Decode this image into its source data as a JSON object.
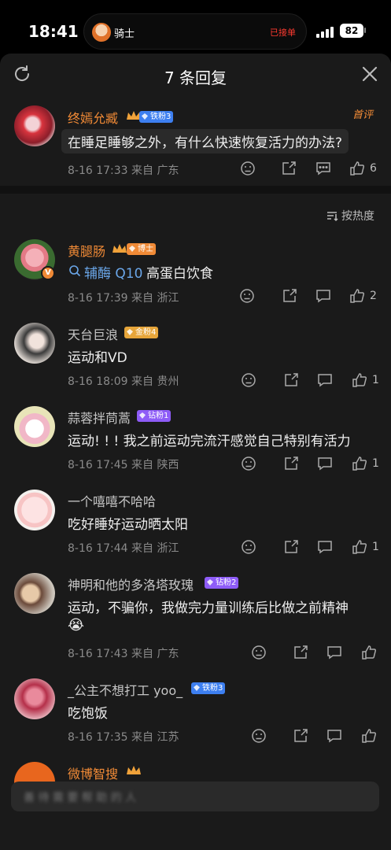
{
  "status_bar": {
    "time": "18:41",
    "island_name": "骑士",
    "island_status": "已接单",
    "battery": "82"
  },
  "header": {
    "title": "7 条回复"
  },
  "root_comment": {
    "user": "终嫣允臧",
    "badge": "铁粉3",
    "tag": "首评",
    "text": "在睡足睡够之外，有什么快速恢复活力的办法?",
    "time": "8-16 17:33 来自 广东",
    "likes": "6"
  },
  "sort_label": "按热度",
  "replies": [
    {
      "user": "黄腿肠",
      "badge": "博士",
      "search_prefix": "辅酶 Q10",
      "text": "高蛋白饮食",
      "time": "8-16 17:39 来自 浙江",
      "likes": "2"
    },
    {
      "user": "天台巨浪",
      "badge": "金粉4",
      "text": "运动和VD",
      "time": "8-16 18:09 来自 贵州",
      "likes": "1"
    },
    {
      "user": "蒜蓉拌茼蒿",
      "badge": "钻粉1",
      "text": "运动! ! ! 我之前运动完流汗感觉自己特别有活力",
      "time": "8-16 17:45 来自 陕西",
      "likes": "1"
    },
    {
      "user": "一个嘻嘻不哈哈",
      "text": "吃好睡好运动晒太阳",
      "time": "8-16 17:44 来自 浙江",
      "likes": "1"
    },
    {
      "user": "神明和他的多洛塔玫瑰",
      "badge": "钻粉2",
      "text": "运动，不骗你，我做完力量训练后比做之前精神",
      "emoji": "😭",
      "time": "8-16 17:43 来自 广东",
      "likes": ""
    },
    {
      "user": "_公主不想打工 yoo_",
      "badge": "铁粉3",
      "text": "吃饱饭",
      "time": "8-16 17:35 来自 江苏",
      "likes": ""
    },
    {
      "user": "微博智搜"
    }
  ],
  "input": {
    "placeholder": "善 待 需 要 帮 助 的 人"
  },
  "colors": {
    "accent": "#f08a36",
    "background": "#1a1a1a",
    "iron_badge": "#3d7ff0",
    "gold_badge": "#e6a53a",
    "diamond_badge": "#8e5cf7"
  }
}
